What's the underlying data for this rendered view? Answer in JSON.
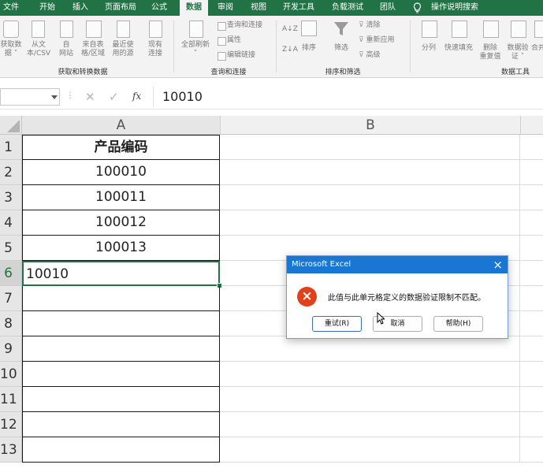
{
  "ribbon_tabs": [
    {
      "label": "文件"
    },
    {
      "label": "开始"
    },
    {
      "label": "插入"
    },
    {
      "label": "页面布局"
    },
    {
      "label": "公式"
    },
    {
      "label": "数据"
    },
    {
      "label": "审阅"
    },
    {
      "label": "视图"
    },
    {
      "label": "开发工具"
    },
    {
      "label": "负载测试"
    },
    {
      "label": "团队"
    },
    {
      "label": "操作说明搜索"
    }
  ],
  "ribbon": {
    "get_data": [
      "获取数",
      "据 ˅"
    ],
    "from_csv": [
      "从文",
      "本/CSV"
    ],
    "from_web": [
      "自",
      "网站"
    ],
    "from_table": [
      "来自表",
      "格/区域"
    ],
    "recent_sources": [
      "最近使",
      "用的源"
    ],
    "existing": [
      "现有",
      "连接"
    ],
    "refresh_all": [
      "全部刷新",
      "˅"
    ],
    "queries": "查询和连接",
    "properties": "属性",
    "edit_links": "编辑链接",
    "sort_asc": "A↓Z",
    "sort_desc": "Z↓A",
    "sort": "排序",
    "filter": "筛选",
    "clear": "清除",
    "reapply": "重新应用",
    "advanced": "高级",
    "text_to_columns": "分列",
    "flash_fill": "快速填充",
    "remove_dup": [
      "删除",
      "重复值"
    ],
    "data_validation": [
      "数据验",
      "证 ˅"
    ],
    "consolidate": "合并",
    "groups": {
      "get_transform": "获取和转换数据",
      "queries_connections": "查询和连接",
      "sort_filter": "排序和筛选",
      "data_tools": "数据工具"
    }
  },
  "formula_bar": {
    "value": "10010",
    "fx": "fx"
  },
  "columns": [
    "A",
    "B"
  ],
  "rows": [
    {
      "num": "1",
      "a": "产品编码"
    },
    {
      "num": "2",
      "a": "100010"
    },
    {
      "num": "3",
      "a": "100011"
    },
    {
      "num": "4",
      "a": "100012"
    },
    {
      "num": "5",
      "a": "100013"
    },
    {
      "num": "6",
      "a": "10010"
    },
    {
      "num": "7",
      "a": ""
    },
    {
      "num": "8",
      "a": ""
    },
    {
      "num": "9",
      "a": ""
    },
    {
      "num": "10",
      "a": ""
    },
    {
      "num": "11",
      "a": ""
    },
    {
      "num": "12",
      "a": ""
    },
    {
      "num": "13",
      "a": ""
    }
  ],
  "dialog": {
    "title": "Microsoft Excel",
    "message": "此值与此单元格定义的数据验证限制不匹配。",
    "close": "×",
    "error_icon": "×",
    "retry": "重试(R)",
    "cancel": "取消",
    "help": "帮助(H)"
  },
  "colors": {
    "accent": "#217346",
    "dialog_title": "#1976d2",
    "error_red": "#e0401a",
    "selection": "#217346"
  }
}
